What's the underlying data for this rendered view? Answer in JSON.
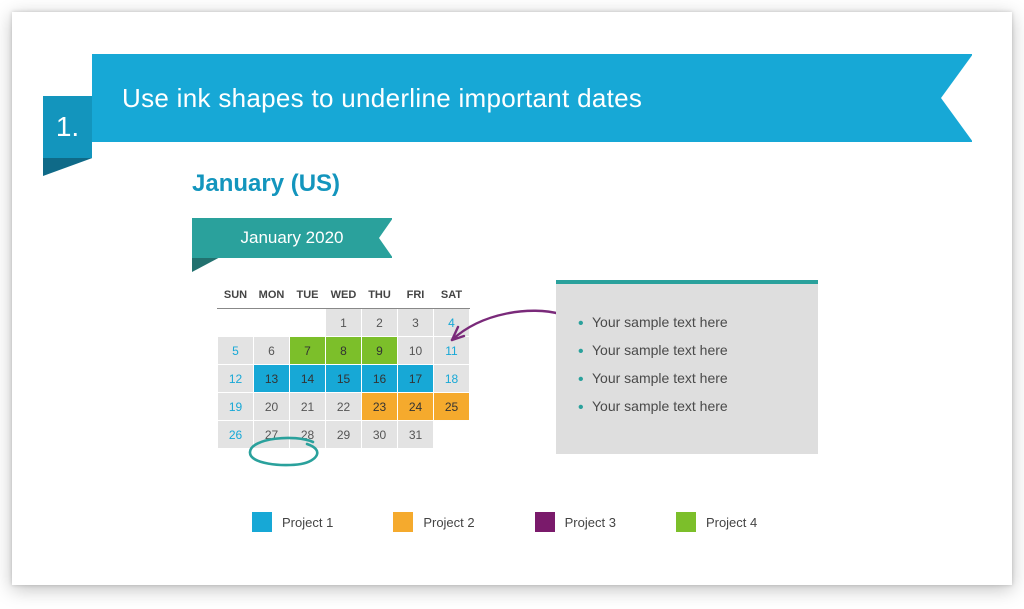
{
  "title": {
    "number": "1.",
    "text": "Use ink shapes to underline important dates"
  },
  "section_heading": "January (US)",
  "month_label": "January 2020",
  "calendar": {
    "headers": [
      "SUN",
      "MON",
      "TUE",
      "WED",
      "THU",
      "FRI",
      "SAT"
    ],
    "rows": [
      [
        {
          "v": "",
          "cls": "blank"
        },
        {
          "v": "",
          "cls": "blank"
        },
        {
          "v": "",
          "cls": "blank"
        },
        {
          "v": "1",
          "cls": ""
        },
        {
          "v": "2",
          "cls": ""
        },
        {
          "v": "3",
          "cls": ""
        },
        {
          "v": "4",
          "cls": "weekend"
        }
      ],
      [
        {
          "v": "5",
          "cls": "weekend"
        },
        {
          "v": "6",
          "cls": ""
        },
        {
          "v": "7",
          "cls": "p4"
        },
        {
          "v": "8",
          "cls": "p4"
        },
        {
          "v": "9",
          "cls": "p4"
        },
        {
          "v": "10",
          "cls": ""
        },
        {
          "v": "11",
          "cls": "weekend"
        }
      ],
      [
        {
          "v": "12",
          "cls": "weekend"
        },
        {
          "v": "13",
          "cls": "p1"
        },
        {
          "v": "14",
          "cls": "p1"
        },
        {
          "v": "15",
          "cls": "p1"
        },
        {
          "v": "16",
          "cls": "p1"
        },
        {
          "v": "17",
          "cls": "p1"
        },
        {
          "v": "18",
          "cls": "weekend"
        }
      ],
      [
        {
          "v": "19",
          "cls": "weekend"
        },
        {
          "v": "20",
          "cls": ""
        },
        {
          "v": "21",
          "cls": ""
        },
        {
          "v": "22",
          "cls": ""
        },
        {
          "v": "23",
          "cls": "p2"
        },
        {
          "v": "24",
          "cls": "p2"
        },
        {
          "v": "25",
          "cls": "p2 weekend"
        }
      ],
      [
        {
          "v": "26",
          "cls": "weekend"
        },
        {
          "v": "27",
          "cls": ""
        },
        {
          "v": "28",
          "cls": ""
        },
        {
          "v": "29",
          "cls": ""
        },
        {
          "v": "30",
          "cls": ""
        },
        {
          "v": "31",
          "cls": ""
        },
        {
          "v": "",
          "cls": "blank"
        }
      ]
    ]
  },
  "textbox": {
    "items": [
      "Your sample text here",
      "Your sample text here",
      "Your sample text here",
      "Your sample text here"
    ]
  },
  "legend": [
    {
      "label": "Project 1",
      "cls": "sw1"
    },
    {
      "label": "Project 2",
      "cls": "sw2"
    },
    {
      "label": "Project 3",
      "cls": "sw3"
    },
    {
      "label": "Project 4",
      "cls": "sw4"
    }
  ],
  "colors": {
    "primary_blue": "#17a8d6",
    "teal": "#2aa19c",
    "orange": "#f5aa2d",
    "purple": "#7a1a6b",
    "green": "#7cbf2a"
  }
}
